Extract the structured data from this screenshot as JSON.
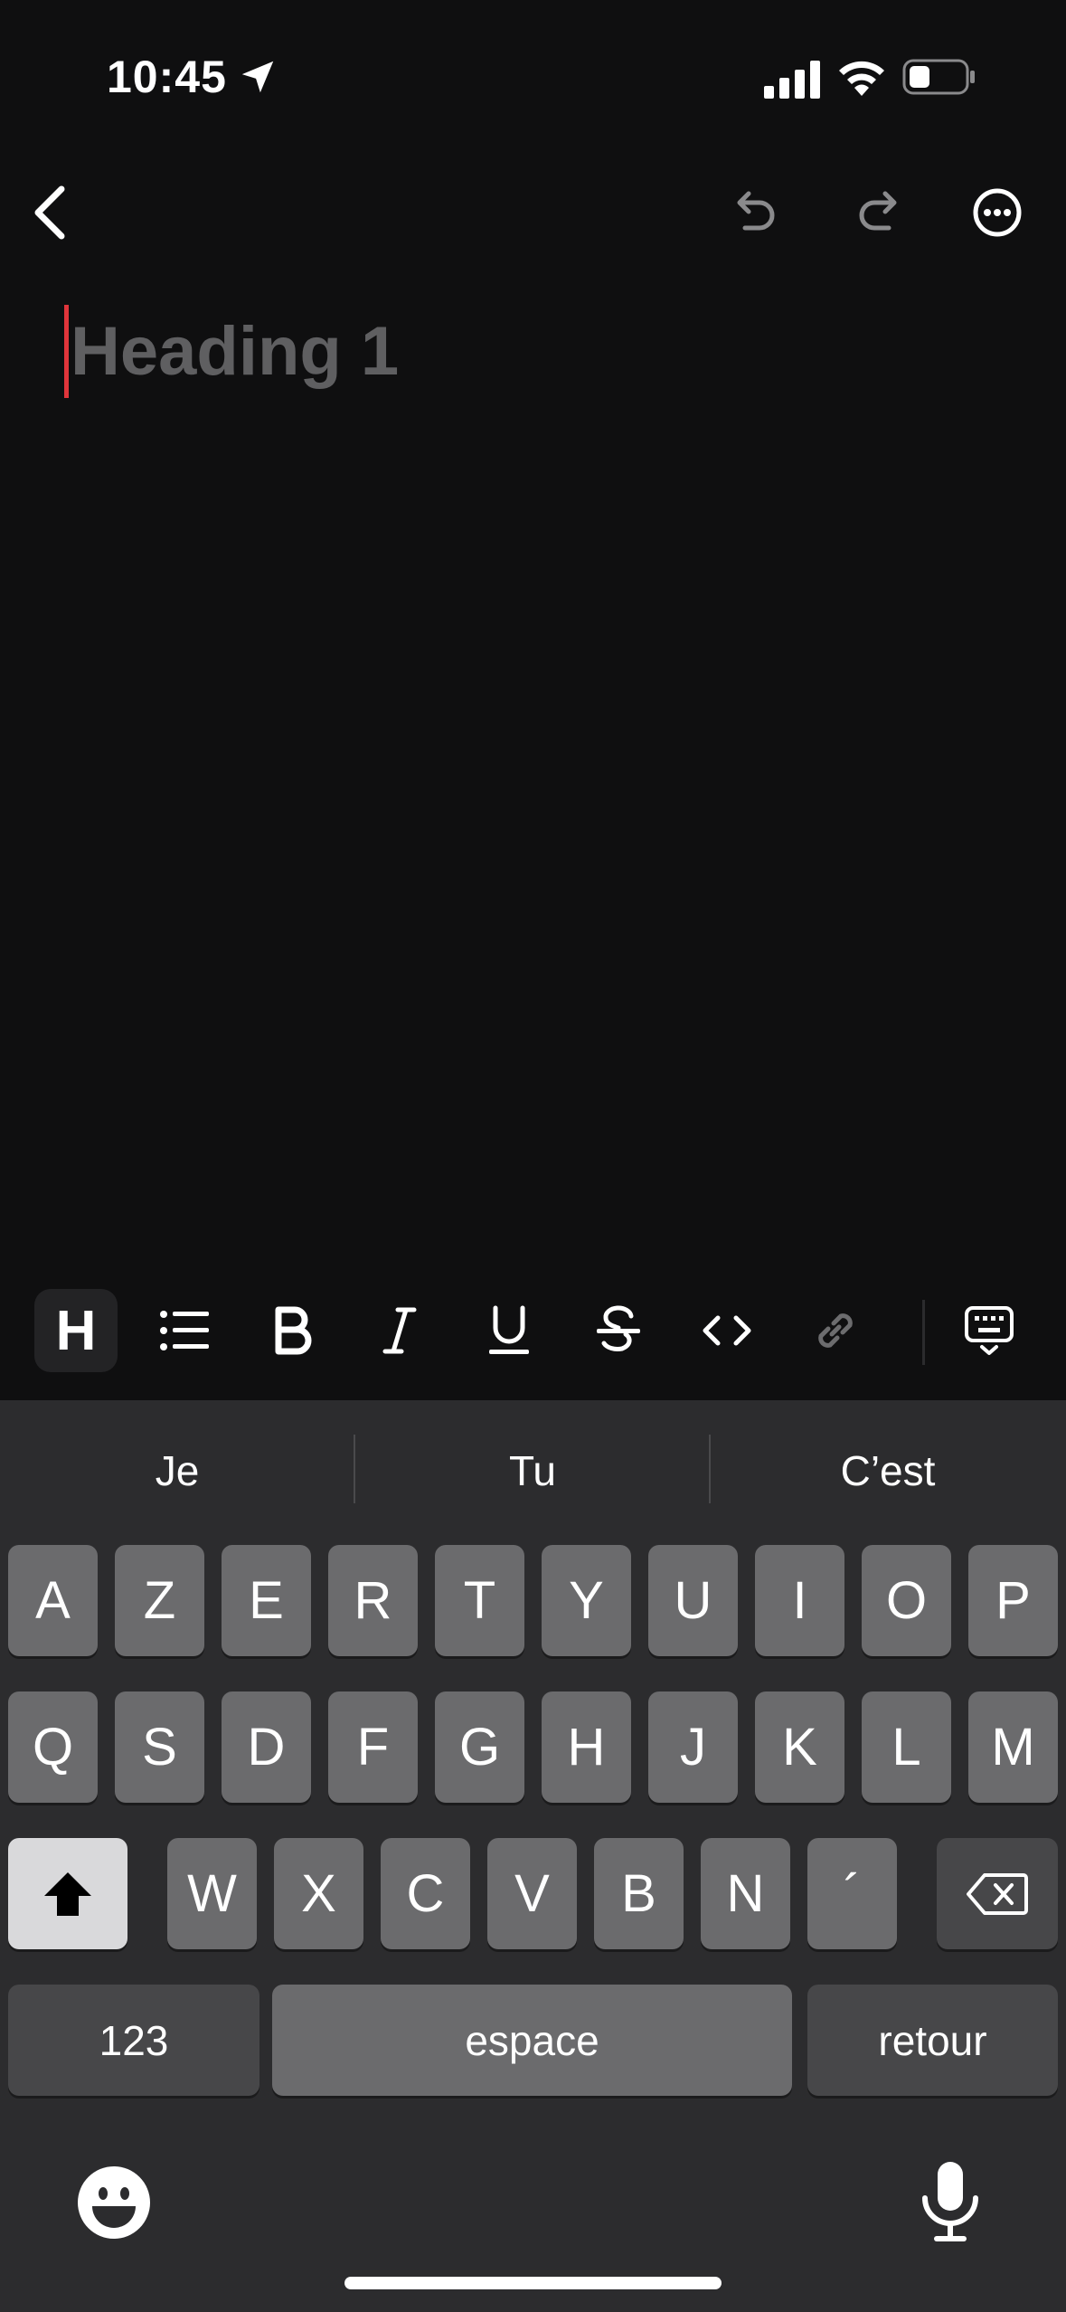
{
  "status_bar": {
    "time": "10:45",
    "icons": [
      "location-arrow-icon",
      "cellular-signal-icon",
      "wifi-icon",
      "battery-icon"
    ]
  },
  "nav": {
    "icons": [
      "chevron-left-icon",
      "undo-icon",
      "redo-icon",
      "more-icon"
    ]
  },
  "editor": {
    "placeholder": "Heading 1",
    "caret_color": "#e0353b"
  },
  "toolbar": {
    "tools": [
      "heading",
      "bullet-list",
      "bold",
      "italic",
      "underline",
      "strikethrough",
      "code",
      "link",
      "keyboard-dismiss"
    ],
    "heading_label": "H",
    "active": "heading"
  },
  "keyboard": {
    "suggestions": [
      "Je",
      "Tu",
      "C’est"
    ],
    "row1": [
      "A",
      "Z",
      "E",
      "R",
      "T",
      "Y",
      "U",
      "I",
      "O",
      "P"
    ],
    "row2": [
      "Q",
      "S",
      "D",
      "F",
      "G",
      "H",
      "J",
      "K",
      "L",
      "M"
    ],
    "row3": [
      "W",
      "X",
      "C",
      "V",
      "B",
      "N",
      "´"
    ],
    "numbers_label": "123",
    "space_label": "espace",
    "return_label": "retour"
  },
  "colors": {
    "background": "#0f0f10",
    "keyboard_bg": "#2c2c2e",
    "key": "#6b6b6d",
    "accent": "#e0353b"
  }
}
